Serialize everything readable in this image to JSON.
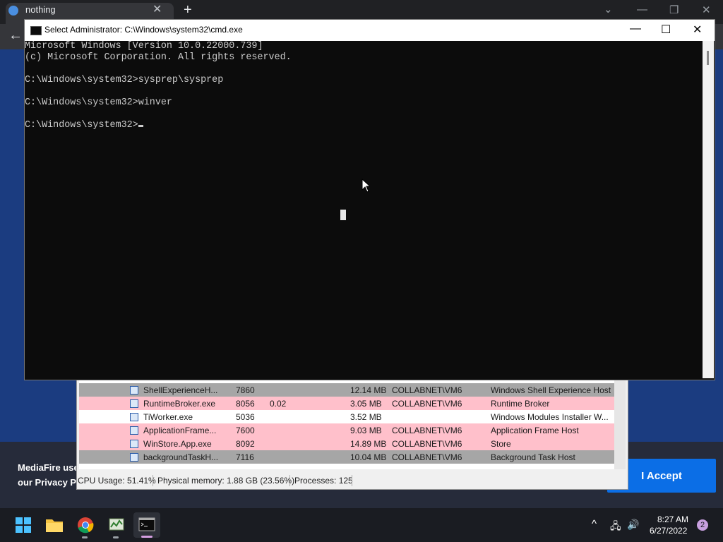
{
  "browser": {
    "tab_title": "nothing",
    "new_tab": "+",
    "close_tab": "✕",
    "back": "←",
    "minimize": "—",
    "restore": "❐",
    "close": "✕",
    "dropdown": "⌄"
  },
  "banner": {
    "line1": "MediaFire use",
    "line2": "our Privacy Po",
    "accept_label": "I Accept"
  },
  "process_explorer": {
    "rows": [
      {
        "name": "ShellExperienceH...",
        "pid": "7860",
        "cpu": "",
        "mem": "12.14 MB",
        "user": "COLLABNET\\VM6",
        "desc": "Windows Shell Experience Host",
        "bg": "#a6a6a6"
      },
      {
        "name": "RuntimeBroker.exe",
        "pid": "8056",
        "cpu": "0.02",
        "mem": "3.05 MB",
        "user": "COLLABNET\\VM6",
        "desc": "Runtime Broker",
        "bg": "#ffc0cb"
      },
      {
        "name": "TiWorker.exe",
        "pid": "5036",
        "cpu": "",
        "mem": "3.52 MB",
        "user": "",
        "desc": "Windows Modules Installer W...",
        "bg": "#ffffff"
      },
      {
        "name": "ApplicationFrame...",
        "pid": "7600",
        "cpu": "",
        "mem": "9.03 MB",
        "user": "COLLABNET\\VM6",
        "desc": "Application Frame Host",
        "bg": "#ffc0cb"
      },
      {
        "name": "WinStore.App.exe",
        "pid": "8092",
        "cpu": "",
        "mem": "14.89 MB",
        "user": "COLLABNET\\VM6",
        "desc": "Store",
        "bg": "#ffc0cb"
      },
      {
        "name": "backgroundTaskH...",
        "pid": "7116",
        "cpu": "",
        "mem": "10.04 MB",
        "user": "COLLABNET\\VM6",
        "desc": "Background Task Host",
        "bg": "#a6a6a6"
      }
    ],
    "status": {
      "cpu": "CPU Usage: 51.41%",
      "memory": "Physical memory: 1.88 GB (23.56%)",
      "processes": "Processes: 125"
    }
  },
  "cmd": {
    "title": "Select Administrator: C:\\Windows\\system32\\cmd.exe",
    "minimize": "—",
    "maximize": "☐",
    "close": "✕",
    "lines": [
      "Microsoft Windows [Version 10.0.22000.739]",
      "(c) Microsoft Corporation. All rights reserved.",
      "",
      "C:\\Windows\\system32>sysprep\\sysprep",
      "",
      "C:\\Windows\\system32>winver",
      "",
      "C:\\Windows\\system32>"
    ]
  },
  "taskbar": {
    "time": "8:27 AM",
    "date": "6/27/2022",
    "notification_count": "2",
    "chevron": "^",
    "network": "🖧",
    "volume": "🔊"
  },
  "colors": {
    "accent": "#0b6ee6",
    "row_pink": "#ffc0cb",
    "row_gray": "#a6a6a6",
    "terminal_bg": "#0c0c0c",
    "terminal_fg": "#cccccc"
  }
}
